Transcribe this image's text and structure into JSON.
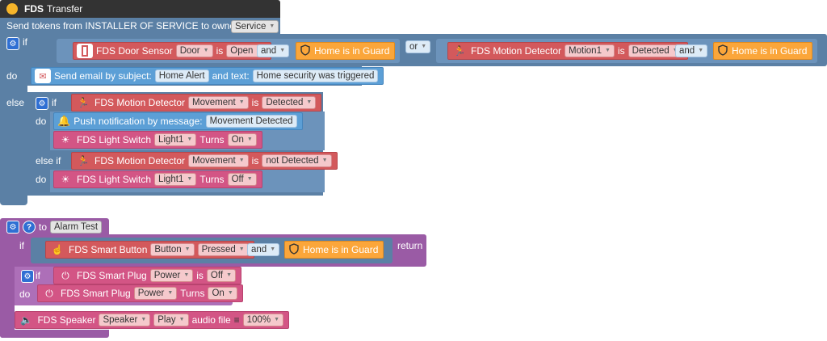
{
  "header": {
    "brand": "FDS",
    "title": "Transfer",
    "send_label": "Send tokens from INSTALLER OF SERVICE to owner of",
    "service_value": "Service"
  },
  "rule1": {
    "if_label": "if",
    "or_label": "or",
    "and_label": "and",
    "door": {
      "device": "FDS Door Sensor",
      "name": "Door",
      "is": "is",
      "state": "Open"
    },
    "guard": "Home is in Guard",
    "motion": {
      "device": "FDS  Motion Detector",
      "name": "Motion1",
      "is": "is",
      "state": "Detected"
    },
    "do_label": "do",
    "email": {
      "text": "Send email by subject:",
      "subject": "Home Alert",
      "and_text": "and text:",
      "body": "Home security was triggered"
    },
    "else_label": "else",
    "inner": {
      "if_label": "if",
      "motion_a": {
        "device": "FDS  Motion Detector",
        "name": "Movement",
        "is": "is",
        "state": "Detected"
      },
      "do_label": "do",
      "push": {
        "text": "Push notification by message:",
        "message": "Movement Detected"
      },
      "light_on": {
        "device": "FDS  Light Switch",
        "name": "Light1",
        "turns": "Turns",
        "state": "On"
      },
      "elseif_label": "else if",
      "motion_b": {
        "device": "FDS  Motion Detector",
        "name": "Movement",
        "is": "is",
        "state": "not Detected"
      },
      "do2_label": "do",
      "light_off": {
        "device": "FDS  Light Switch",
        "name": "Light1",
        "turns": "Turns",
        "state": "Off"
      }
    }
  },
  "func": {
    "to_label": "to",
    "name": "Alarm Test",
    "if_label": "if",
    "return_label": "return",
    "button": {
      "device": "FDS  Smart Button",
      "name": "Button",
      "state": "Pressed"
    },
    "and_label": "and",
    "guard": "Home is in Guard",
    "inner_if": "if",
    "plug_check": {
      "device": "FDS  Smart Plug",
      "name": "Power",
      "is": "is",
      "state": "Off"
    },
    "do_label": "do",
    "plug_set": {
      "device": "FDS Smart Plug",
      "name": "Power",
      "turns": "Turns",
      "state": "On"
    },
    "speaker": {
      "device": "FDS Speaker",
      "name": "Speaker",
      "action": "Play",
      "audio": "audio file",
      "volume": "100%"
    }
  },
  "colors": {
    "steel": "#5b80a5",
    "purple": "#9a5ba5",
    "red_block": "#d3595c",
    "pink_block": "#d35585",
    "orange_block": "#fba63a",
    "blue_block": "#5c9fd6",
    "gear_blue": "#2f6fd3"
  },
  "icons": [
    "fds-logo-icon",
    "gear-icon",
    "help-icon",
    "door-sensor-icon",
    "shield-icon",
    "motion-icon",
    "email-icon",
    "bell-icon",
    "light-switch-icon",
    "smart-button-icon",
    "smart-plug-icon",
    "speaker-icon",
    "list-icon"
  ]
}
